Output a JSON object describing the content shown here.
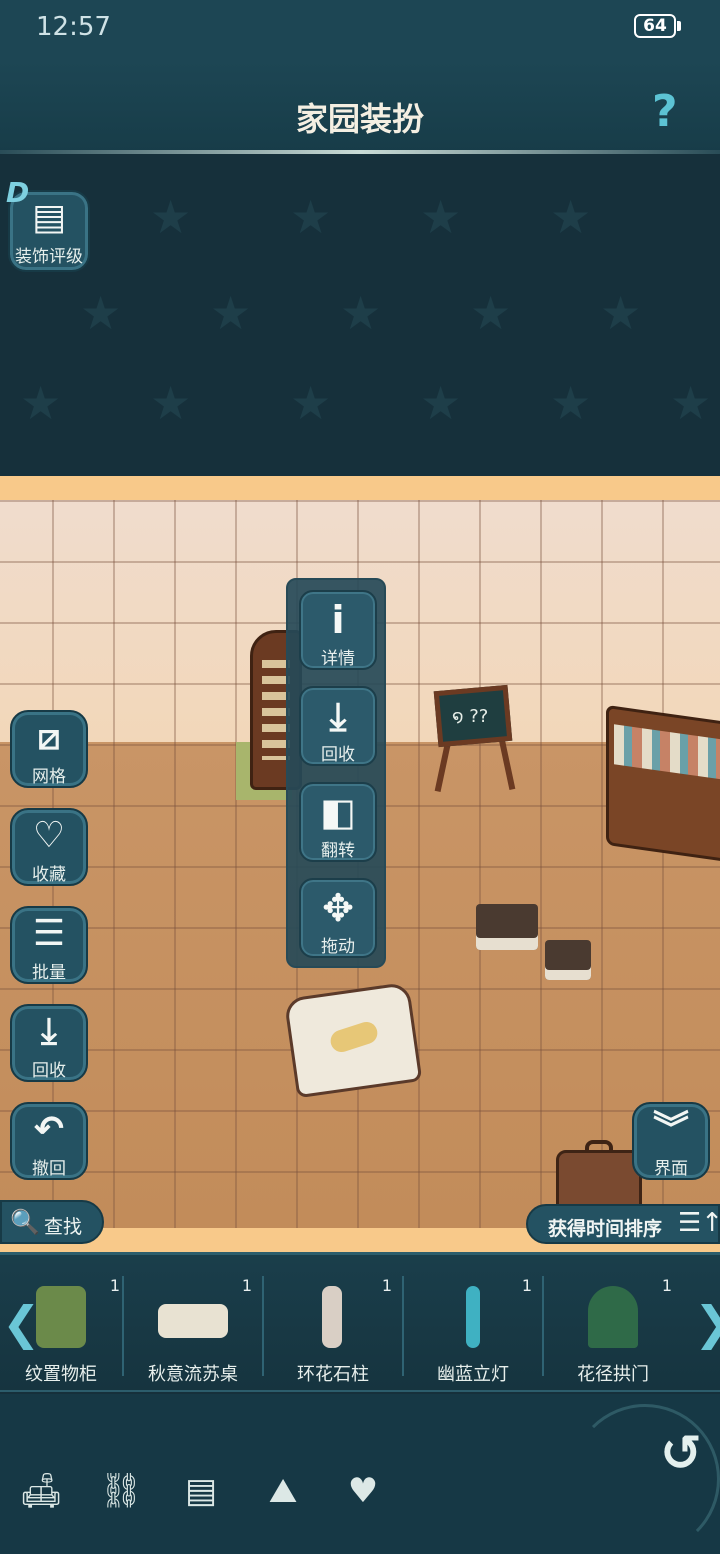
{
  "status_bar": {
    "time": "12:57",
    "battery": "64"
  },
  "header": {
    "title": "家园装扮",
    "help_symbol": "?"
  },
  "rating": {
    "badge": "D",
    "label": "装饰评级"
  },
  "context_menu": [
    {
      "icon": "i",
      "label": "详情"
    },
    {
      "icon": "⤓",
      "label": "回收"
    },
    {
      "icon": "◧",
      "label": "翻转"
    },
    {
      "icon": "✥",
      "label": "拖动"
    }
  ],
  "side_buttons": [
    {
      "icon": "⧄",
      "label": "网格"
    },
    {
      "icon": "♡",
      "label": "收藏"
    },
    {
      "icon": "☰",
      "label": "批量"
    },
    {
      "icon": "⤓",
      "label": "回收"
    },
    {
      "icon": "↶",
      "label": "撤回"
    }
  ],
  "room": {
    "chalkboard_text": "໑ ??"
  },
  "search": {
    "label": "查找",
    "icon": "🔍"
  },
  "sort": {
    "label": "获得时间排序",
    "icon": "☰↑"
  },
  "interface_button": {
    "icon": "︾",
    "label": "界面"
  },
  "items": [
    {
      "name": "纹置物柜",
      "count": "1",
      "color": "#6b8a4a"
    },
    {
      "name": "秋意流苏桌",
      "count": "1",
      "color": "#e8e2d2"
    },
    {
      "name": "环花石柱",
      "count": "1",
      "color": "#d9cfc5"
    },
    {
      "name": "幽蓝立灯",
      "count": "1",
      "color": "#3fb1c2"
    },
    {
      "name": "花径拱门",
      "count": "1",
      "color": "#2f6a48"
    }
  ],
  "nav_arrows": {
    "left": "❮",
    "right": "❯"
  },
  "toolbar": {
    "icons": [
      "sofa-icon",
      "fence-icon",
      "wall-icon",
      "floor-icon",
      "heart-icon"
    ],
    "glyphs": [
      "🛋",
      "⛓",
      "▤",
      "⛰",
      "♥"
    ],
    "undo": "↺"
  },
  "colors": {
    "accent": "#5cc3d4",
    "panel": "#245262",
    "room_wall": "#f0dccd",
    "room_floor": "#c28c5a"
  }
}
